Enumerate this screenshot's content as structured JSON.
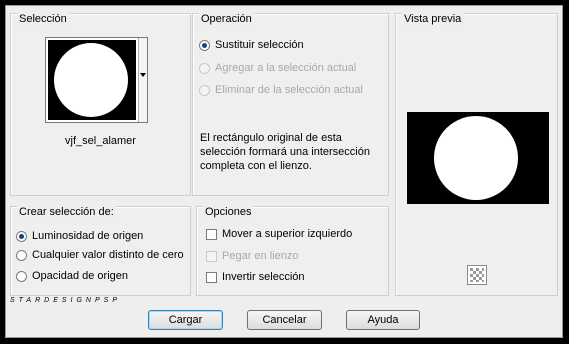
{
  "selection": {
    "title": "Selección",
    "name": "vjf_sel_alamer"
  },
  "operation": {
    "title": "Operación",
    "options": [
      {
        "label": "Sustituir selección",
        "checked": true,
        "enabled": true
      },
      {
        "label": "Agregar a la selección actual",
        "checked": false,
        "enabled": false
      },
      {
        "label": "Eliminar de la selección actual",
        "checked": false,
        "enabled": false
      }
    ],
    "description": "El rectángulo original de esta selección formará una intersección completa con el lienzo."
  },
  "preview": {
    "title": "Vista previa",
    "icon": "transparency-checker-icon"
  },
  "create": {
    "title": "Crear selección de:",
    "options": [
      {
        "label": "Luminosidad de origen",
        "checked": true
      },
      {
        "label": "Cualquier valor distinto de cero",
        "checked": false
      },
      {
        "label": "Opacidad de origen",
        "checked": false
      }
    ]
  },
  "options": {
    "title": "Opciones",
    "items": [
      {
        "label": "Mover a superior izquierdo",
        "checked": false,
        "enabled": true
      },
      {
        "label": "Pegar en lienzo",
        "checked": false,
        "enabled": false
      },
      {
        "label": "Invertir selección",
        "checked": false,
        "enabled": true
      }
    ]
  },
  "watermark": "STARDESIGNPSP",
  "buttons": {
    "load": "Cargar",
    "cancel": "Cancelar",
    "help": "Ayuda"
  },
  "colors": {
    "dialog_bg": "#eeeeee",
    "radio_dot": "#1e3f7a",
    "default_button_border": "#3c7fb1"
  }
}
